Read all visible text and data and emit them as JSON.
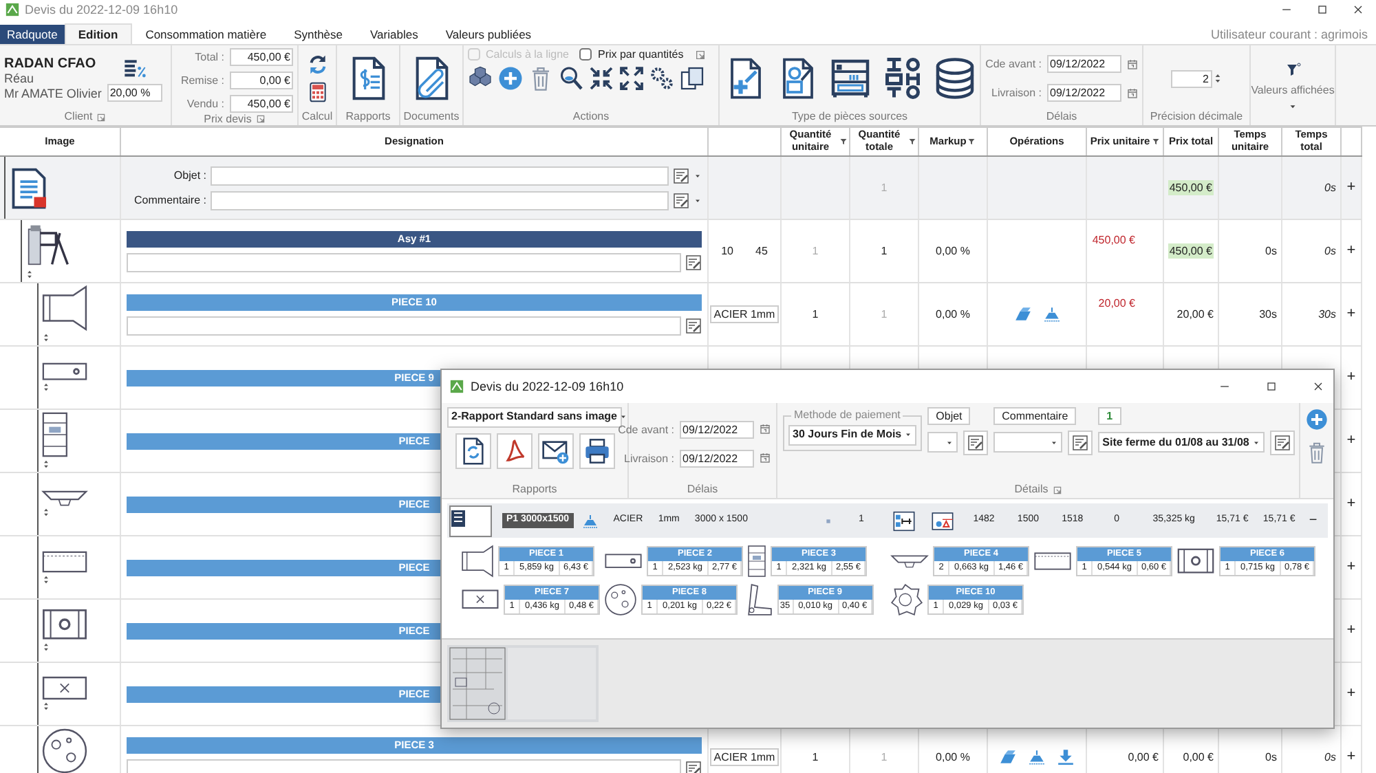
{
  "window": {
    "title": "Devis du 2022-12-09 16h10"
  },
  "app_button": "Radquote",
  "tabs": [
    {
      "label": "Edition",
      "selected": true
    },
    {
      "label": "Consommation matière",
      "selected": false
    },
    {
      "label": "Synthèse",
      "selected": false
    },
    {
      "label": "Variables",
      "selected": false
    },
    {
      "label": "Valeurs publiées",
      "selected": false
    }
  ],
  "current_user": "Utilisateur courant : agrimois",
  "ribbon": {
    "client": {
      "company": "RADAN CFAO",
      "city": "Réau",
      "contact": "Mr AMATE Olivier",
      "rate": "20,00 %",
      "label": "Client"
    },
    "price": {
      "label": "Prix devis",
      "fields": [
        {
          "label": "Total :",
          "value": "450,00 €"
        },
        {
          "label": "Remise :",
          "value": "0,00 €"
        },
        {
          "label": "Vendu :",
          "value": "450,00 €"
        }
      ]
    },
    "calc_label": "Calcul",
    "reports_label": "Rapports",
    "documents_label": "Documents",
    "actions": {
      "label": "Actions",
      "options": [
        {
          "label": "Calculs à la ligne",
          "checked": false,
          "disabled": true
        },
        {
          "label": "Prix par quantités",
          "checked": false,
          "disabled": false
        }
      ]
    },
    "sources_label": "Type de pièces sources",
    "deadlines": {
      "label": "Délais",
      "fields": [
        {
          "label": "Cde avant :",
          "value": "09/12/2022"
        },
        {
          "label": "Livraison :",
          "value": "09/12/2022"
        }
      ]
    },
    "precision": {
      "label": "Précision décimale",
      "value": "2"
    },
    "display": {
      "label": "Valeurs affichées"
    }
  },
  "table": {
    "columns": [
      {
        "label": "Image",
        "filter": false
      },
      {
        "label": "Designation",
        "filter": false
      },
      {
        "label": "Quantité unitaire",
        "filter": true
      },
      {
        "label": "Quantité totale",
        "filter": true
      },
      {
        "label": "Markup",
        "filter": true
      },
      {
        "label": "Opérations",
        "filter": false
      },
      {
        "label": "Prix unitaire",
        "filter": true
      },
      {
        "label": "Prix total",
        "filter": false
      },
      {
        "label": "Temps unitaire",
        "filter": false
      },
      {
        "label": "Temps total",
        "filter": false
      }
    ],
    "rows": [
      {
        "kind": "quote",
        "fields": [
          {
            "label": "Objet :"
          },
          {
            "label": "Commentaire :"
          }
        ],
        "qty_total": {
          "value": "1",
          "muted": true
        },
        "price_total": {
          "value": "450,00 €",
          "highlighted": true
        },
        "time_total": "0s",
        "expand": "+",
        "children": [
          {
            "kind": "assembly",
            "title": "Asy #1",
            "counts": [
              "10",
              "45"
            ],
            "qty_unit": {
              "value": "1",
              "muted": true
            },
            "qty_total": {
              "value": "1",
              "muted": false
            },
            "markup": "0,00 %",
            "price_unit": {
              "value": "450,00 €",
              "alert": true
            },
            "price_total": {
              "value": "450,00 €",
              "highlighted": true
            },
            "time_unit": "0s",
            "time_total": "0s",
            "expand": "+",
            "children": [
              {
                "kind": "part",
                "title": "PIECE 10",
                "material": "ACIER 1mm",
                "qty_unit": {
                  "value": "1",
                  "muted": false
                },
                "qty_total": {
                  "value": "1",
                  "muted": true
                },
                "markup": "0,00 %",
                "operations": [
                  {
                    "kind": "bend"
                  },
                  {
                    "kind": "cut"
                  }
                ],
                "price_unit": {
                  "value": "20,00 €",
                  "alert": true
                },
                "price_total": {
                  "value": "20,00 €",
                  "highlighted": false
                },
                "time_unit": "30s",
                "time_total": "30s",
                "expand": "+"
              },
              {
                "kind": "part",
                "title": "PIECE 9",
                "expand": "+"
              },
              {
                "kind": "part",
                "title": "PIECE",
                "expand": "+"
              },
              {
                "kind": "part",
                "title": "PIECE",
                "expand": "+"
              },
              {
                "kind": "part",
                "title": "PIECE",
                "expand": "+"
              },
              {
                "kind": "part",
                "title": "PIECE",
                "expand": "+"
              },
              {
                "kind": "part",
                "title": "PIECE",
                "expand": "+"
              },
              {
                "kind": "part",
                "title": "PIECE 3",
                "material": "ACIER 1mm",
                "qty_unit": {
                  "value": "1",
                  "muted": false
                },
                "qty_total": {
                  "value": "1",
                  "muted": true
                },
                "markup": "0,00 %",
                "operations": [
                  {
                    "kind": "bend"
                  },
                  {
                    "kind": "cut"
                  },
                  {
                    "kind": "export"
                  }
                ],
                "price_unit": {
                  "value": "0,00 €",
                  "alert": false
                },
                "price_total": {
                  "value": "0,00 €",
                  "highlighted": false
                },
                "time_unit": "0s",
                "time_total": "0s",
                "expand": "+"
              }
            ]
          }
        ]
      }
    ]
  },
  "dialog": {
    "title": "Devis du 2022-12-09 16h10",
    "report": "2-Rapport Standard sans image",
    "reports_label": "Rapports",
    "deadlines": {
      "label": "Délais",
      "fields": [
        {
          "label": "Cde avant :",
          "value": "09/12/2022"
        },
        {
          "label": "Livraison :",
          "value": "09/12/2022"
        }
      ]
    },
    "payment": {
      "legend": "Methode de paiement",
      "value": "30 Jours Fin de Mois"
    },
    "detail_groups": [
      {
        "kind": "field",
        "label": "Objet"
      },
      {
        "kind": "field",
        "label": "Commentaire"
      },
      {
        "kind": "counter",
        "label": "1",
        "value": "Site ferme du 01/08 au 31/08"
      }
    ],
    "details_label": "Détails",
    "sheet": {
      "name": "P1 3000x1500",
      "material": "ACIER",
      "thickness": "1mm",
      "size": "3000 x 1500",
      "quantity": "1",
      "values": [
        "1482",
        "1500",
        "1518",
        "0"
      ],
      "weight": "35,325 kg",
      "price_unit": "15,71 €",
      "price_total": "15,71 €",
      "collapse": "−"
    },
    "parts": [
      {
        "name": "PIECE 1",
        "qty": "1",
        "weight": "5,859 kg",
        "price": "6,43 €"
      },
      {
        "name": "PIECE 2",
        "qty": "1",
        "weight": "2,523 kg",
        "price": "2,77 €"
      },
      {
        "name": "PIECE 3",
        "qty": "1",
        "weight": "2,321 kg",
        "price": "2,55 €"
      },
      {
        "name": "PIECE 4",
        "qty": "2",
        "weight": "0,663 kg",
        "price": "1,46 €"
      },
      {
        "name": "PIECE 5",
        "qty": "1",
        "weight": "0,544 kg",
        "price": "0,60 €"
      },
      {
        "name": "PIECE 6",
        "qty": "1",
        "weight": "0,715 kg",
        "price": "0,78 €"
      },
      {
        "name": "PIECE 7",
        "qty": "1",
        "weight": "0,436 kg",
        "price": "0,48 €"
      },
      {
        "name": "PIECE 8",
        "qty": "1",
        "weight": "0,201 kg",
        "price": "0,22 €"
      },
      {
        "name": "PIECE 9",
        "qty": "35",
        "weight": "0,010 kg",
        "price": "0,40 €"
      },
      {
        "name": "PIECE 10",
        "qty": "1",
        "weight": "0,029 kg",
        "price": "0,03 €"
      }
    ]
  }
}
